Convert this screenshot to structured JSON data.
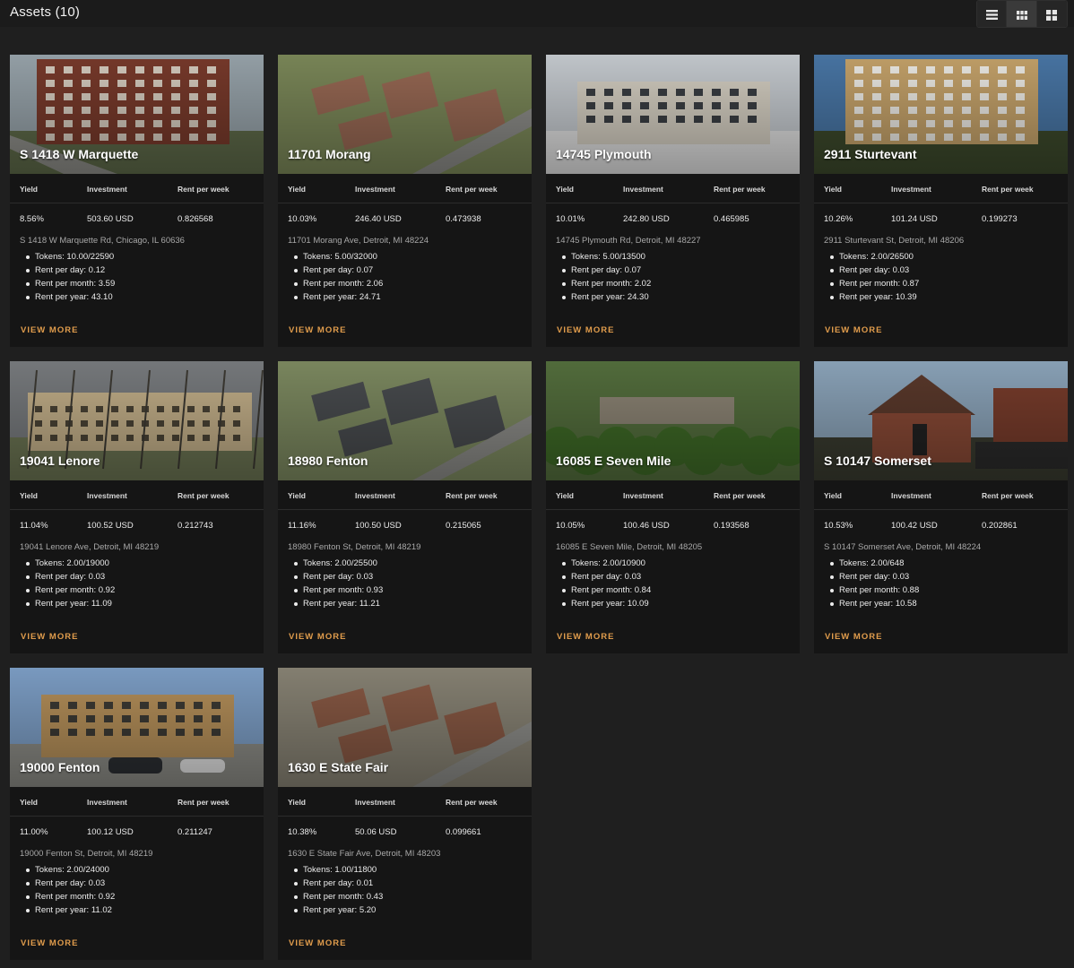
{
  "header": {
    "title": "Assets (10)",
    "view_modes": [
      {
        "icon": "list-view-icon",
        "active": false
      },
      {
        "icon": "grid-small-view-icon",
        "active": true
      },
      {
        "icon": "grid-large-view-icon",
        "active": false
      }
    ]
  },
  "labels": {
    "yield": "Yield",
    "investment": "Investment",
    "rent_per_week": "Rent per week",
    "view_more": "VIEW MORE"
  },
  "colors": {
    "background": "#1f1f1f",
    "card": "#151515",
    "accent": "#e09c4c"
  },
  "assets": [
    {
      "name": "S 1418 W Marquette",
      "yield": "8.56%",
      "investment": "503.60 USD",
      "rent_per_week": "0.826568",
      "address": "S 1418 W Marquette Rd, Chicago, IL 60636",
      "tokens": "Tokens: 10.00/22590",
      "rent_day": "Rent per day: 0.12",
      "rent_month": "Rent per month: 3.59",
      "rent_year": "Rent per year: 43.10",
      "palette": "brick"
    },
    {
      "name": "11701 Morang",
      "yield": "10.03%",
      "investment": "246.40 USD",
      "rent_per_week": "0.473938",
      "address": "11701 Morang Ave, Detroit, MI 48224",
      "tokens": "Tokens: 5.00/32000",
      "rent_day": "Rent per day: 0.07",
      "rent_month": "Rent per month: 2.06",
      "rent_year": "Rent per year: 24.71",
      "palette": "aerial"
    },
    {
      "name": "14745 Plymouth",
      "yield": "10.01%",
      "investment": "242.80 USD",
      "rent_per_week": "0.465985",
      "address": "14745 Plymouth Rd, Detroit, MI 48227",
      "tokens": "Tokens: 5.00/13500",
      "rent_day": "Rent per day: 0.07",
      "rent_month": "Rent per month: 2.02",
      "rent_year": "Rent per year: 24.30",
      "palette": "snow"
    },
    {
      "name": "2911 Sturtevant",
      "yield": "10.26%",
      "investment": "101.24 USD",
      "rent_per_week": "0.199273",
      "address": "2911 Sturtevant St, Detroit, MI 48206",
      "tokens": "Tokens: 2.00/26500",
      "rent_day": "Rent per day: 0.03",
      "rent_month": "Rent per month: 0.87",
      "rent_year": "Rent per year: 10.39",
      "palette": "tan"
    },
    {
      "name": "19041 Lenore",
      "yield": "11.04%",
      "investment": "100.52 USD",
      "rent_per_week": "0.212743",
      "address": "19041 Lenore Ave, Detroit, MI 48219",
      "tokens": "Tokens: 2.00/19000",
      "rent_day": "Rent per day: 0.03",
      "rent_month": "Rent per month: 0.92",
      "rent_year": "Rent per year: 11.09",
      "palette": "trees"
    },
    {
      "name": "18980 Fenton",
      "yield": "11.16%",
      "investment": "100.50 USD",
      "rent_per_week": "0.215065",
      "address": "18980 Fenton St, Detroit, MI 48219",
      "tokens": "Tokens: 2.00/25500",
      "rent_day": "Rent per day: 0.03",
      "rent_month": "Rent per month: 0.93",
      "rent_year": "Rent per year: 11.21",
      "palette": "roof"
    },
    {
      "name": "16085 E Seven Mile",
      "yield": "10.05%",
      "investment": "100.46 USD",
      "rent_per_week": "0.193568",
      "address": "16085 E Seven Mile, Detroit, MI 48205",
      "tokens": "Tokens: 2.00/10900",
      "rent_day": "Rent per day: 0.03",
      "rent_month": "Rent per month: 0.84",
      "rent_year": "Rent per year: 10.09",
      "palette": "green"
    },
    {
      "name": "S 10147 Somerset",
      "yield": "10.53%",
      "investment": "100.42 USD",
      "rent_per_week": "0.202861",
      "address": "S 10147 Somerset Ave, Detroit, MI 48224",
      "tokens": "Tokens: 2.00/648",
      "rent_day": "Rent per day: 0.03",
      "rent_month": "Rent per month: 0.88",
      "rent_year": "Rent per year: 10.58",
      "palette": "house"
    },
    {
      "name": "19000 Fenton",
      "yield": "11.00%",
      "investment": "100.12 USD",
      "rent_per_week": "0.211247",
      "address": "19000 Fenton St, Detroit, MI 48219",
      "tokens": "Tokens: 2.00/24000",
      "rent_day": "Rent per day: 0.03",
      "rent_month": "Rent per month: 0.92",
      "rent_year": "Rent per year: 11.02",
      "palette": "sky"
    },
    {
      "name": "1630 E State Fair",
      "yield": "10.38%",
      "investment": "50.06 USD",
      "rent_per_week": "0.099661",
      "address": "1630 E State Fair Ave, Detroit, MI 48203",
      "tokens": "Tokens: 1.00/11800",
      "rent_day": "Rent per day: 0.01",
      "rent_month": "Rent per month: 0.43",
      "rent_year": "Rent per year: 5.20",
      "palette": "street"
    }
  ]
}
